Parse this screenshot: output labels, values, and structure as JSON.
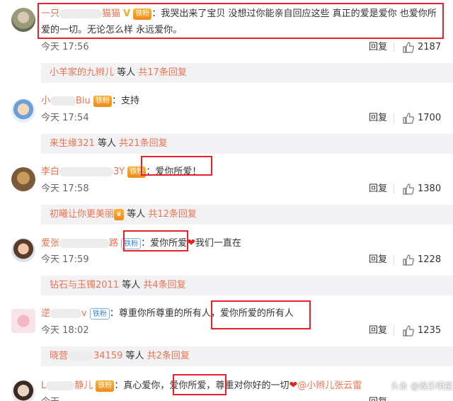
{
  "comments": [
    {
      "name_visible": "一只",
      "name_tail": "猫猫",
      "text_line1": "：我哭出来了宝贝 没想过你能亲自回应这些 真正的爱是爱你 也爱你所",
      "text_line2": "爱的一切。无论怎么样 永远爱你。",
      "badge": "铁粉",
      "time": "今天 17:56",
      "reply_label": "回复",
      "likes": "2187",
      "sub_name": "小羊家的九辫儿",
      "sub_mid": " 等人 ",
      "sub_count": "共17条回复"
    },
    {
      "name_visible": "小",
      "name_tail": "Biu",
      "text": "：支持",
      "badge": "铁粉",
      "time": "今天 17:54",
      "reply_label": "回复",
      "likes": "1700",
      "sub_name": "来生缘321",
      "sub_mid": " 等人 ",
      "sub_count": "共21条回复"
    },
    {
      "name_visible": "李白",
      "name_tail": "3Y",
      "text": "：爱你所爱！",
      "badge": "铁粉",
      "time": "今天 17:58",
      "reply_label": "回复",
      "likes": "1380",
      "sub_name": "初曦让你更美丽",
      "sub_mid": " 等人 ",
      "sub_count": "共12条回复"
    },
    {
      "name_visible": "爱张",
      "name_tail": "路",
      "text_a": "：爱你所爱",
      "text_b": "我们一直在",
      "badge": "铁粉",
      "time": "今天 17:59",
      "reply_label": "回复",
      "likes": "1228",
      "sub_name": "钻石与玉镯2011",
      "sub_mid": " 等人 ",
      "sub_count": "共4条回复"
    },
    {
      "name_visible": "逆",
      "name_tail": "v",
      "text_a": "：尊重你所尊重的所有人，",
      "text_b": "爱你所爱的所有人",
      "badge": "铁粉",
      "time": "今天 18:02",
      "reply_label": "回复",
      "likes": "1235",
      "sub_name": "晓营",
      "sub_name_tail": "34159",
      "sub_mid": " 等人 ",
      "sub_count": "共2条回复"
    },
    {
      "name_visible": "L",
      "name_tail": "静儿",
      "text_a": "：真心爱你，",
      "text_b": "爱你所爱，",
      "text_c": "尊重对你好的一切",
      "mention": "@小辫儿张云雷",
      "badge": "铁粉",
      "time": "今天",
      "reply_label": "回复"
    }
  ],
  "watermark": "头条 @娱乐明星汇",
  "colors": {
    "accent": "#eb7350",
    "highlight_box": "#e8222c",
    "sub_bg": "#f2f2f5"
  }
}
